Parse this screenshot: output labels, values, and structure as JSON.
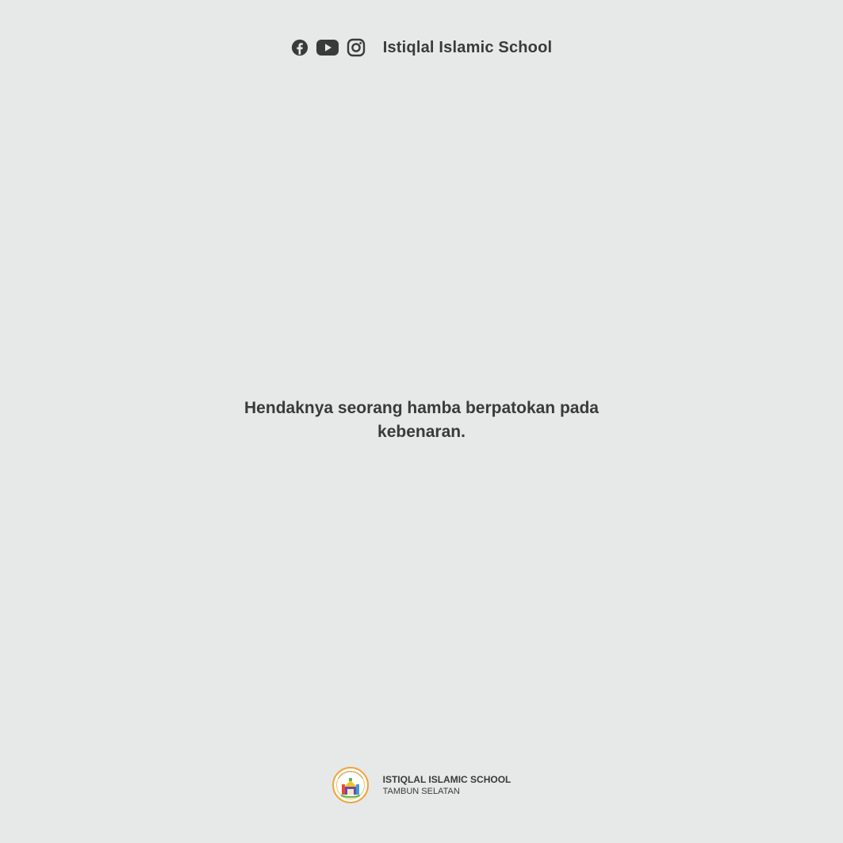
{
  "header": {
    "title": "Istiqlal Islamic School",
    "socials": [
      {
        "icon": "facebook-icon"
      },
      {
        "icon": "youtube-icon"
      },
      {
        "icon": "instagram-icon"
      }
    ]
  },
  "main": {
    "message": "Hendaknya seorang hamba berpatokan pada kebenaran."
  },
  "footer": {
    "logo_icon": "school-logo",
    "name": "ISTIQLAL ISLAMIC SCHOOL",
    "location": "TAMBUN SELATAN"
  },
  "colors": {
    "background": "#e6e9e8",
    "text": "#3a3a3a"
  }
}
